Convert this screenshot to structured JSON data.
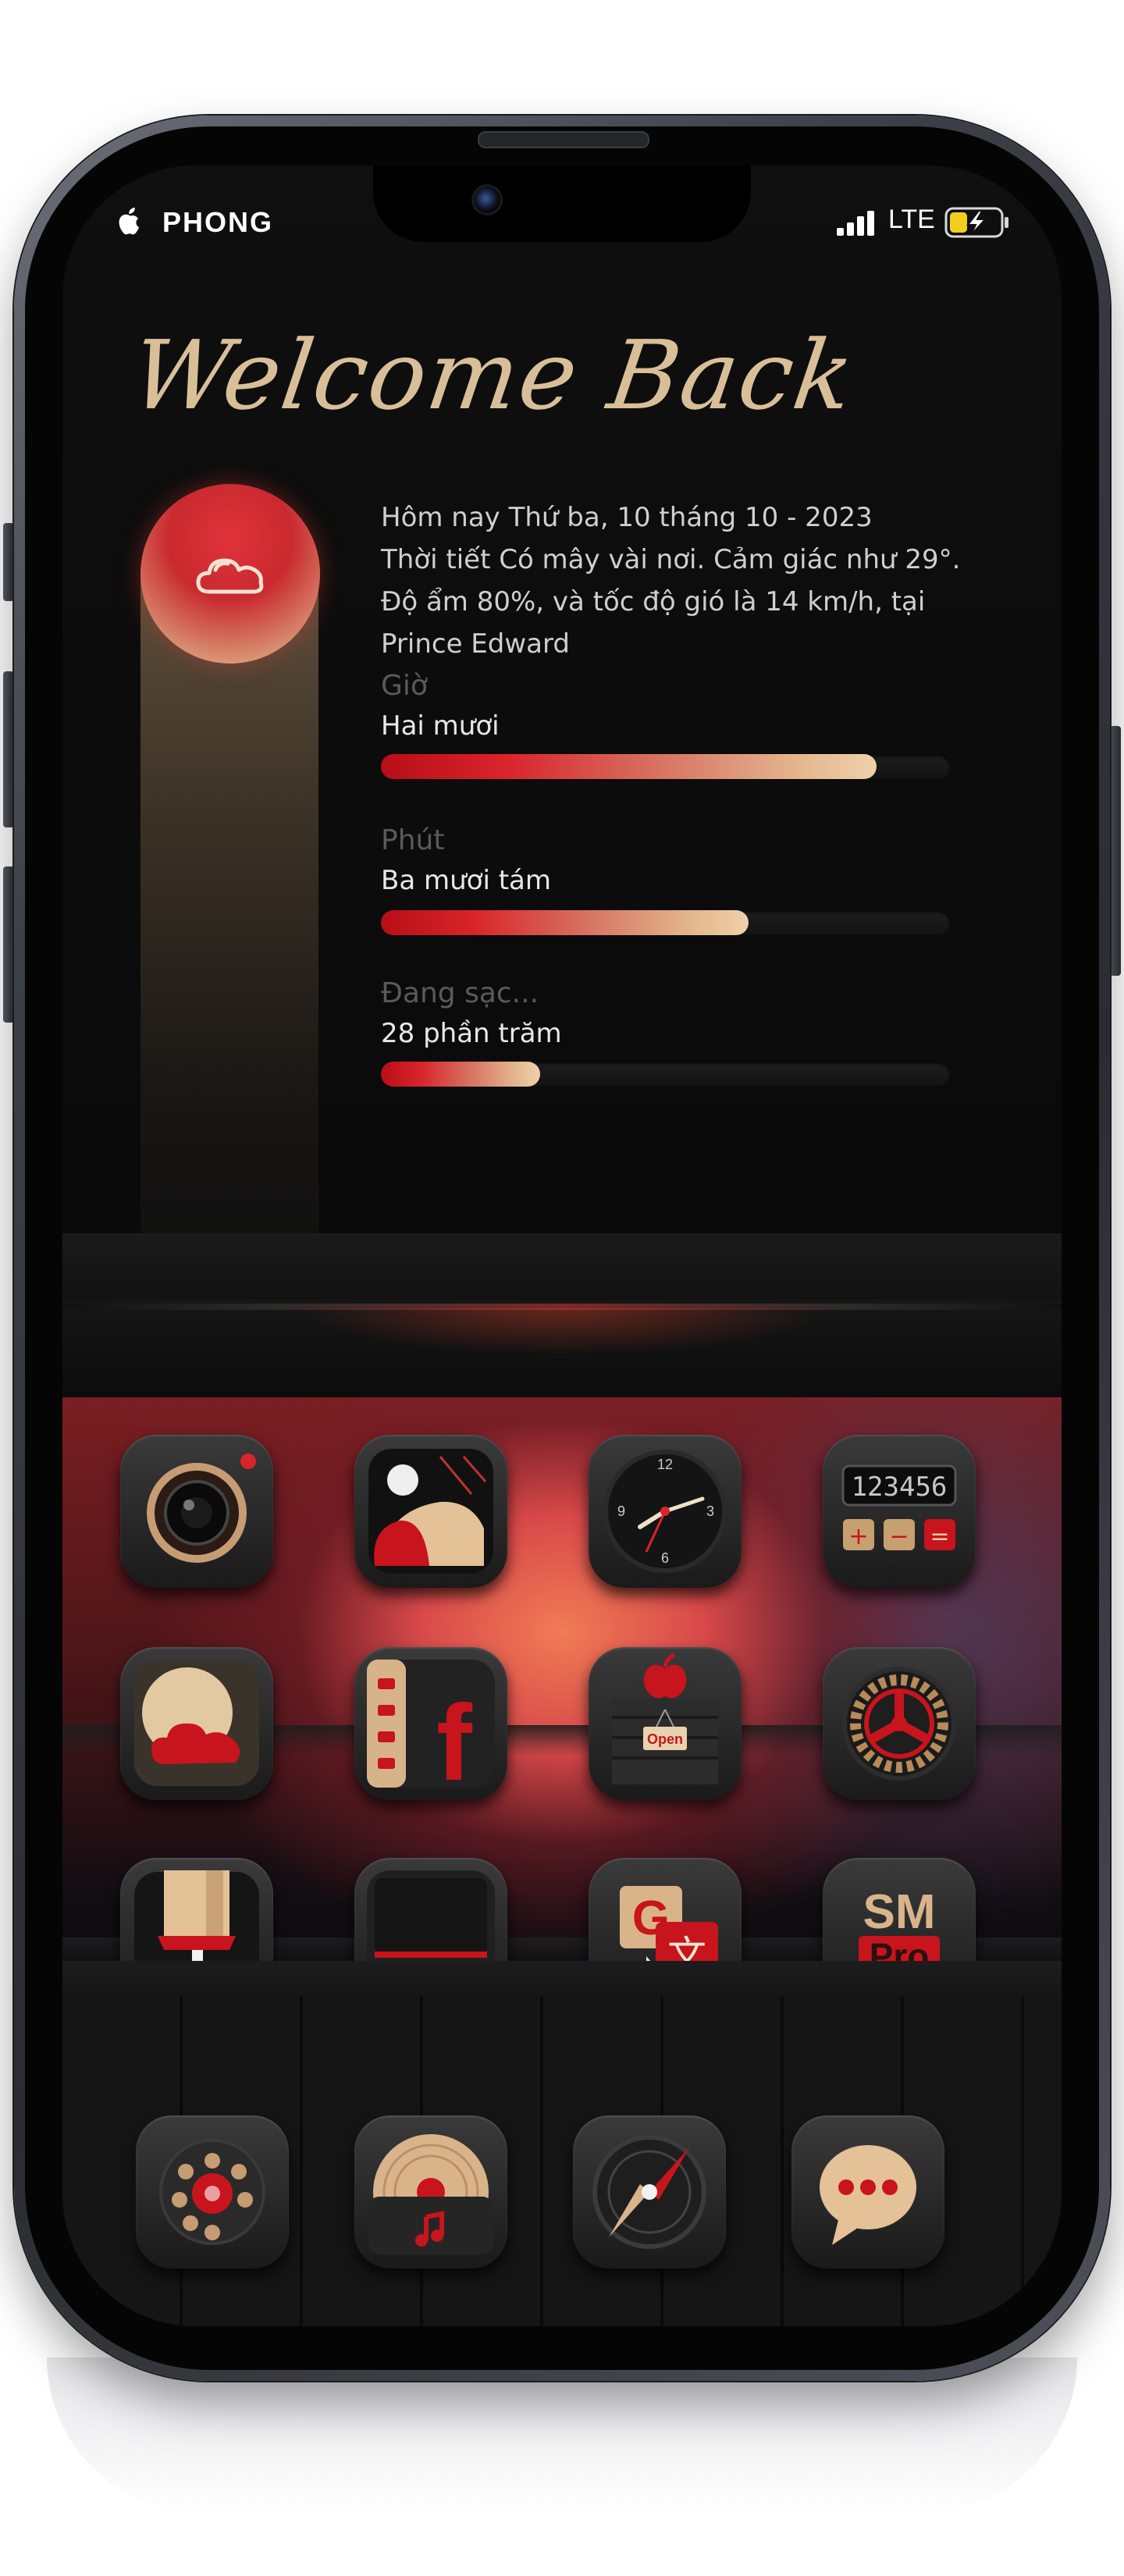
{
  "status_bar": {
    "carrier": "PHONG",
    "network": "LTE",
    "apple_icon": "apple-logo-icon",
    "signal_icon": "cellular-signal-icon",
    "battery_icon": "battery-charging-icon"
  },
  "widget": {
    "title": "Welcome Back",
    "weather_icon": "partly-cloudy-icon",
    "info_lines": [
      "Hôm nay Thứ ba, 10 tháng 10 - 2023",
      "Thời tiết Có mây vài nơi. Cảm giác như 29°.",
      "Độ ẩm 80%, và tốc độ gió là 14 km/h, tại",
      "Prince Edward"
    ],
    "bars": [
      {
        "label": "Giờ",
        "value_text": "Hai mươi",
        "progress": 0.87
      },
      {
        "label": "Phút",
        "value_text": "Ba mươi tám",
        "progress": 0.645
      },
      {
        "label": "Đang sạc...",
        "value_text": "28 phần trăm",
        "progress": 0.28
      }
    ]
  },
  "apps": [
    {
      "icon": "camera-icon"
    },
    {
      "icon": "dial-widget-icon"
    },
    {
      "icon": "clock-icon"
    },
    {
      "icon": "calculator-icon",
      "display": "123456"
    },
    {
      "icon": "weather-moon-icon"
    },
    {
      "icon": "facebook-icon",
      "letter": "f"
    },
    {
      "icon": "app-store-icon",
      "sign": "Open"
    },
    {
      "icon": "settings-gear-icon"
    },
    {
      "icon": "paint-brush-icon"
    },
    {
      "icon": "music-player-icon"
    },
    {
      "icon": "translate-icon",
      "letter_a": "G",
      "letter_b": "文"
    },
    {
      "icon": "sm-pro-icon",
      "line1": "SM",
      "line2": "Pro"
    }
  ],
  "dock": [
    {
      "icon": "rotary-phone-icon"
    },
    {
      "icon": "music-vinyl-icon"
    },
    {
      "icon": "compass-icon"
    },
    {
      "icon": "messages-icon"
    }
  ],
  "colors": {
    "accent_red": "#d8242a",
    "accent_gold": "#e4b88f",
    "title_gold": "#d9bf98",
    "background": "#0b0b0b"
  }
}
